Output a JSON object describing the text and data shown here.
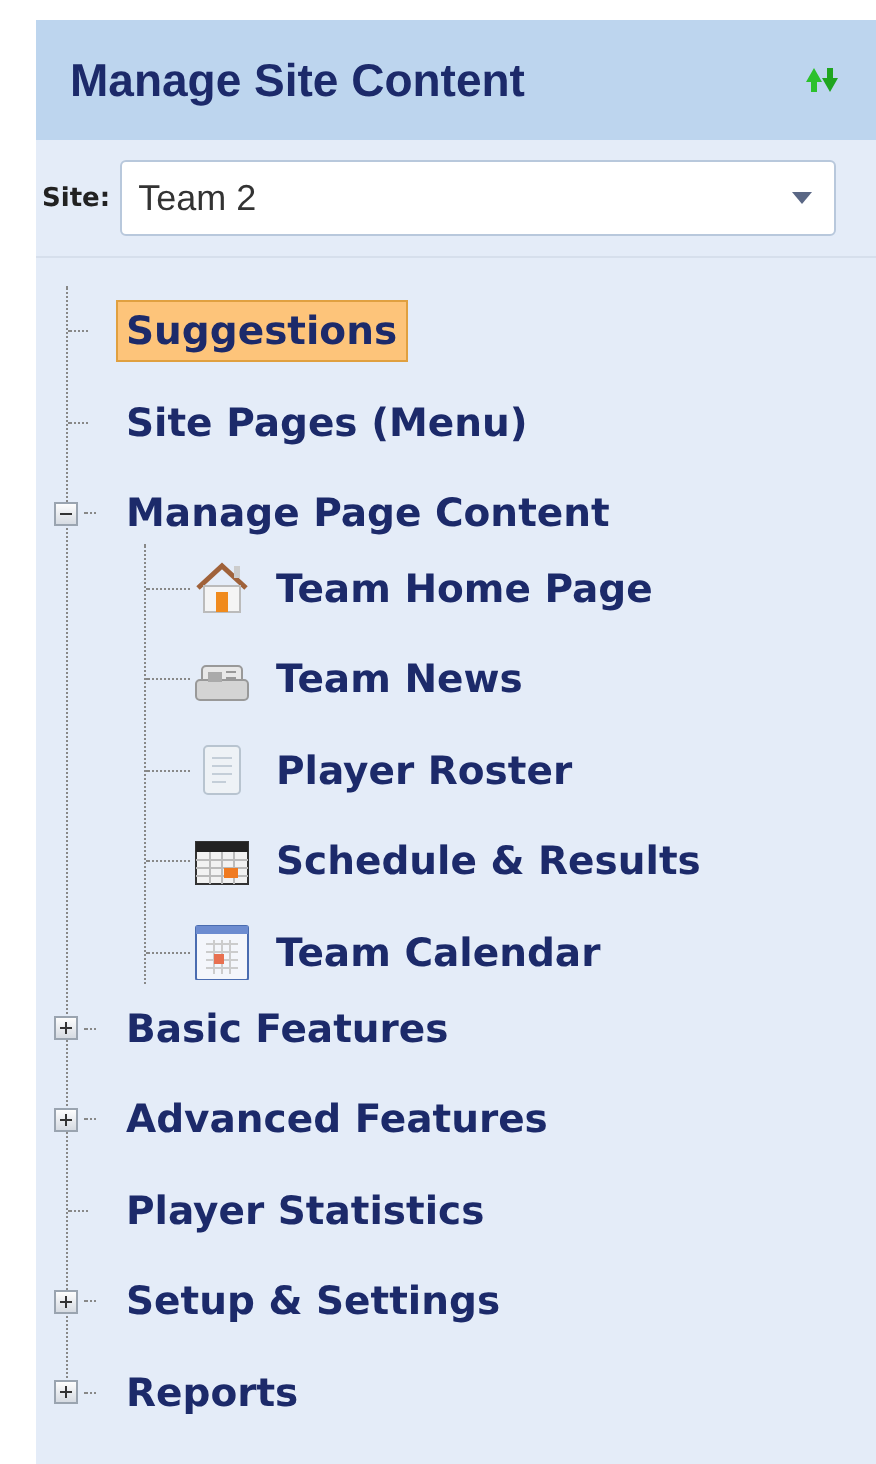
{
  "panel": {
    "title": "Manage Site Content"
  },
  "site": {
    "label": "Site:",
    "value": "Team 2"
  },
  "tree": [
    {
      "label": "Suggestions",
      "selected": true
    },
    {
      "label": "Site Pages (Menu)",
      "selected": false
    },
    {
      "label": "Manage Page Content",
      "selected": false,
      "expanded": true,
      "children": [
        {
          "label": "Team Home Page",
          "selected": false,
          "kind": "house"
        },
        {
          "label": "Team News",
          "selected": false,
          "kind": "newspaper"
        },
        {
          "label": "Player Roster",
          "selected": false,
          "kind": "document"
        },
        {
          "label": "Schedule & Results",
          "selected": false,
          "kind": "schedule"
        },
        {
          "label": "Team Calendar",
          "selected": false,
          "kind": "calendar"
        }
      ]
    },
    {
      "label": "Basic Features",
      "selected": false,
      "expanded": false
    },
    {
      "label": "Advanced Features",
      "selected": false,
      "expanded": false
    },
    {
      "label": "Player Statistics",
      "selected": false
    },
    {
      "label": "Setup & Settings",
      "selected": false,
      "expanded": false
    },
    {
      "label": "Reports",
      "selected": false,
      "expanded": false
    }
  ]
}
